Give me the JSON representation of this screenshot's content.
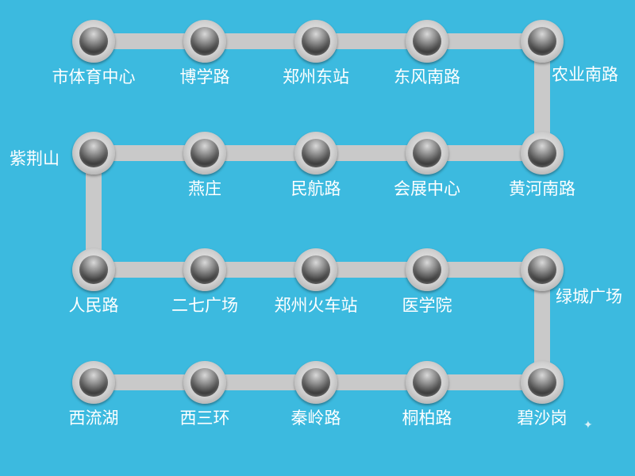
{
  "lines": [
    [
      "市体育中心",
      "博学路",
      "郑州东站",
      "东风南路",
      "农业南路"
    ],
    [
      "紫荆山",
      "燕庄",
      "民航路",
      "会展中心",
      "黄河南路"
    ],
    [
      "人民路",
      "二七广场",
      "郑州火车站",
      "医学院",
      "绿城广场"
    ],
    [
      "西流湖",
      "西三环",
      "秦岭路",
      "桐柏路",
      "碧沙岗"
    ]
  ],
  "colors": {
    "background": "#3cbadf",
    "track": "#c9c9c9",
    "label": "#ffffff"
  }
}
